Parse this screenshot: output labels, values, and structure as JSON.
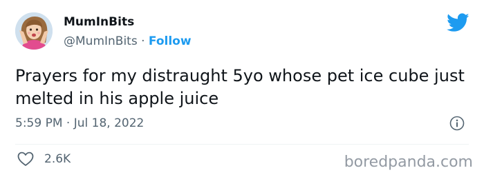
{
  "author": {
    "name": "MumInBits",
    "handle": "@MumInBits",
    "separator": "·",
    "follow_label": "Follow",
    "avatar_icon": "cartoon-woman-avatar"
  },
  "tweet": {
    "text": "Prayers for my distraught 5yo whose pet ice cube just melted in his apple juice",
    "timestamp": "5:59 PM · Jul 18, 2022"
  },
  "actions": {
    "like_icon": "heart-outline-icon",
    "like_count": "2.6K",
    "info_icon": "info-circle-icon"
  },
  "branding": {
    "bird_icon": "twitter-bird-icon",
    "watermark": "boredpanda.com"
  },
  "colors": {
    "accent": "#1d9bf0",
    "text": "#0f1419",
    "muted": "#536471",
    "divider": "#eff3f4"
  }
}
